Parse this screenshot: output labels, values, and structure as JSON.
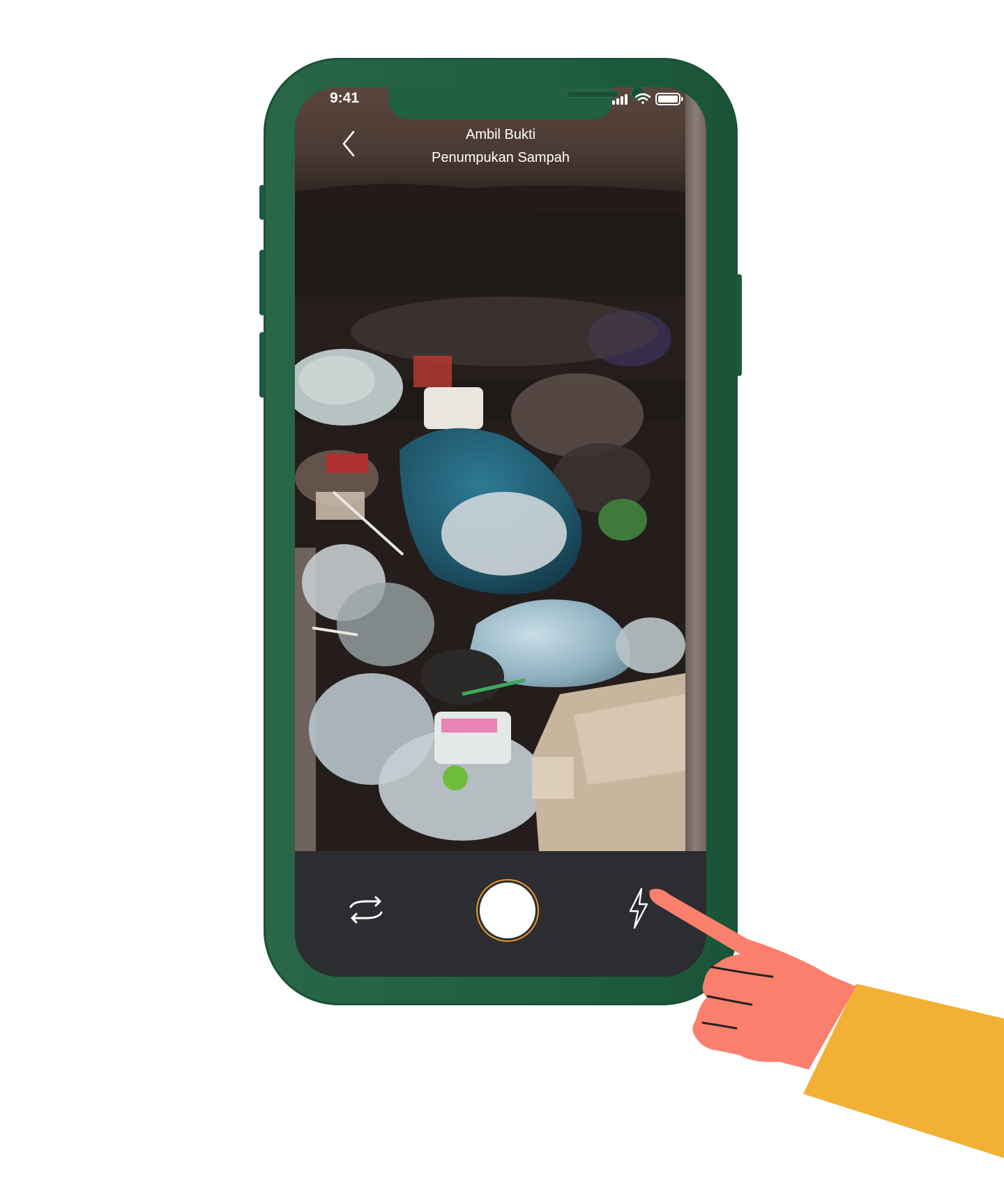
{
  "status_bar": {
    "time": "9:41"
  },
  "header": {
    "title_line1": "Ambil Bukti",
    "title_line2": "Penumpukan Sampah",
    "back_icon": "chevron-left-icon"
  },
  "camera_controls": {
    "switch_icon": "camera-switch-icon",
    "shutter_icon": "shutter-button",
    "flash_icon": "flash-icon",
    "shutter_ring_color": "#e8952a"
  },
  "colors": {
    "phone_body": "#1f5e3f",
    "bottom_bar": "#2b2d31",
    "hand_skin": "#fa7f6c",
    "sleeve": "#f2b134"
  }
}
